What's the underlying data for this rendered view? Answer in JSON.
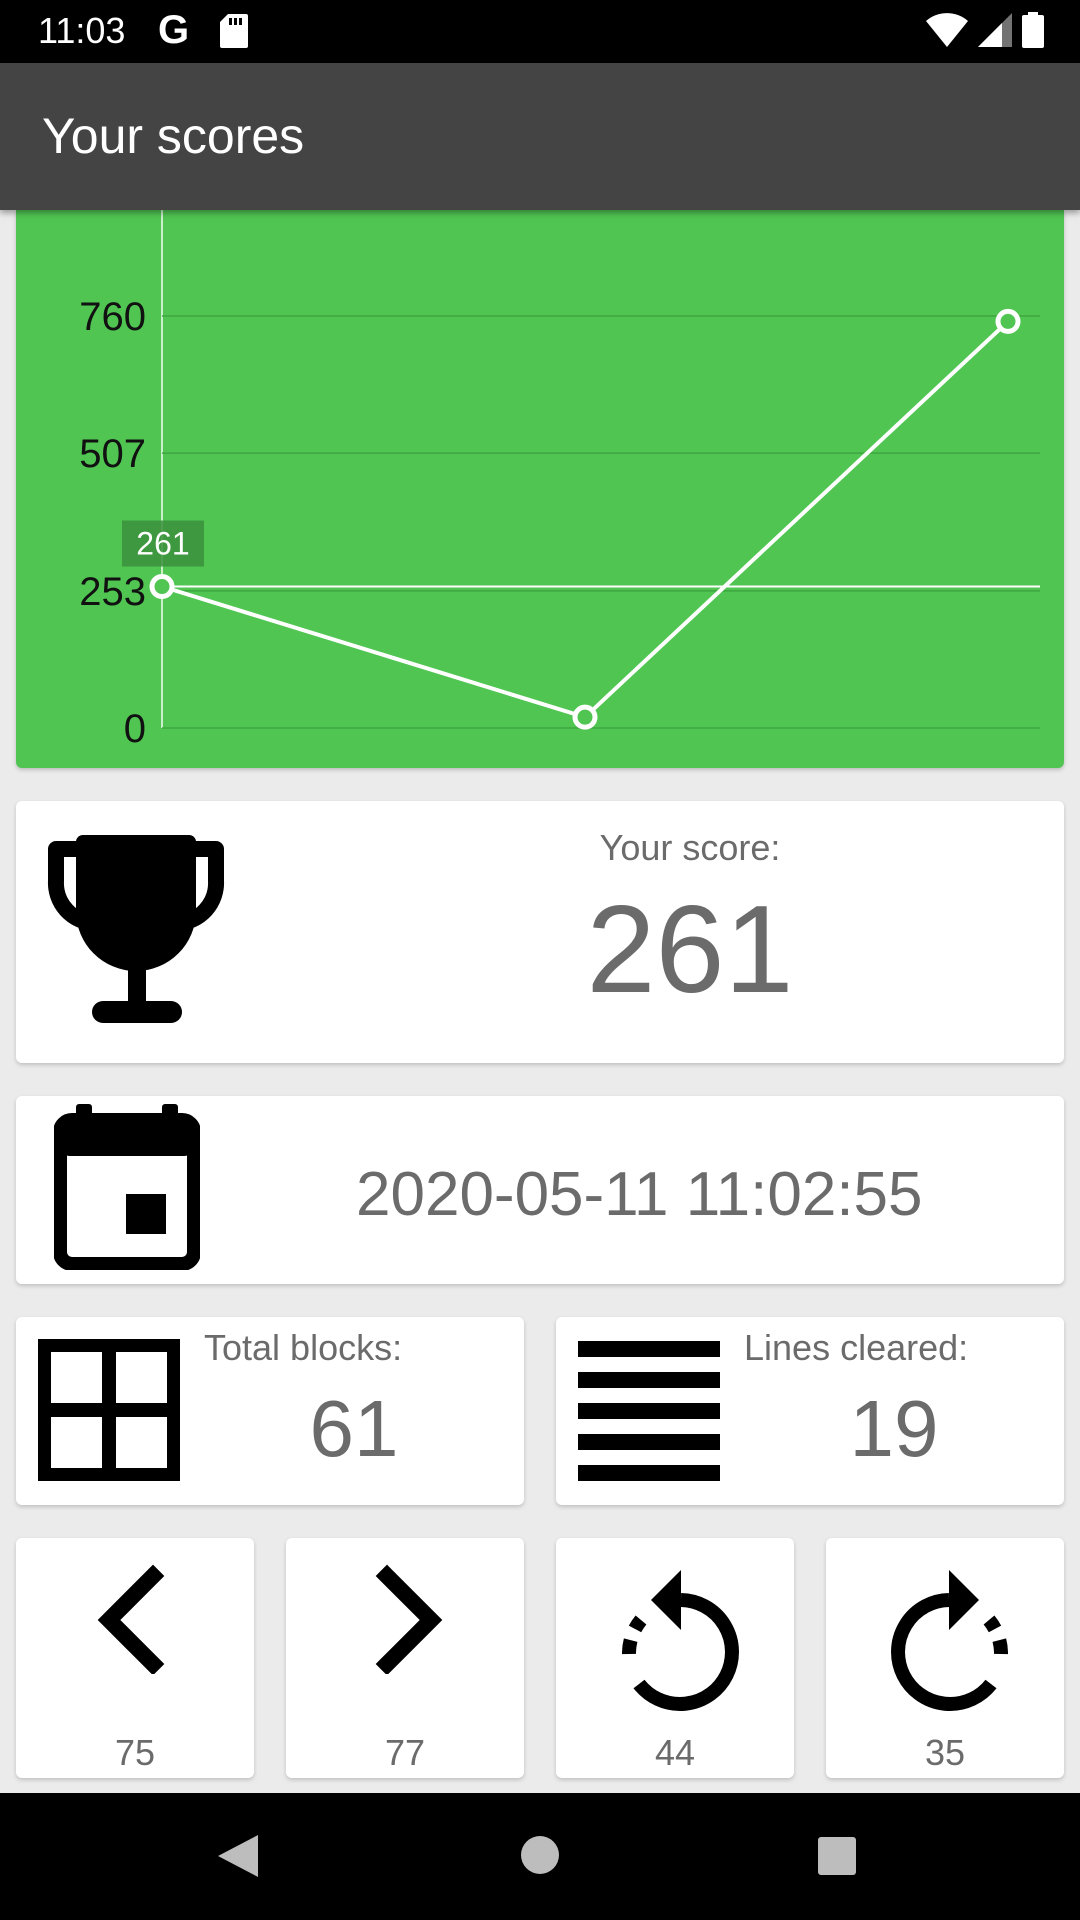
{
  "status_bar": {
    "time": "11:03",
    "g_glyph": "G",
    "icons": [
      "google-icon",
      "sd-card-icon",
      "wifi-icon",
      "signal-icon",
      "battery-icon"
    ]
  },
  "app_bar": {
    "title": "Your scores"
  },
  "chart_data": {
    "type": "line",
    "categories": [
      "",
      "",
      ""
    ],
    "series": [
      {
        "values": [
          261,
          20,
          750
        ]
      }
    ],
    "y_ticks": [
      "0",
      "253",
      "507",
      "760"
    ],
    "ylim": [
      0,
      760
    ],
    "highlight": {
      "index": 0,
      "label": "261"
    },
    "grid": true,
    "colors": {
      "background": "#50c552",
      "line": "#ffffff",
      "marker_label_bg": "#3b8f3d"
    }
  },
  "score": {
    "label": "Your score:",
    "value": "261",
    "icon": "trophy-icon"
  },
  "date": {
    "value": "2020-05-11 11:02:55",
    "icon": "calendar-icon"
  },
  "stats": {
    "blocks": {
      "label": "Total blocks:",
      "value": "61",
      "icon": "grid-icon"
    },
    "lines": {
      "label": "Lines cleared:",
      "value": "19",
      "icon": "lines-icon"
    }
  },
  "moves": [
    {
      "value": "75",
      "icon": "chevron-left-icon"
    },
    {
      "value": "77",
      "icon": "chevron-right-icon"
    },
    {
      "value": "44",
      "icon": "rotate-left-icon"
    },
    {
      "value": "35",
      "icon": "rotate-right-icon"
    }
  ],
  "nav_bar": {
    "icons": [
      "back-icon",
      "home-icon",
      "recents-icon"
    ]
  }
}
